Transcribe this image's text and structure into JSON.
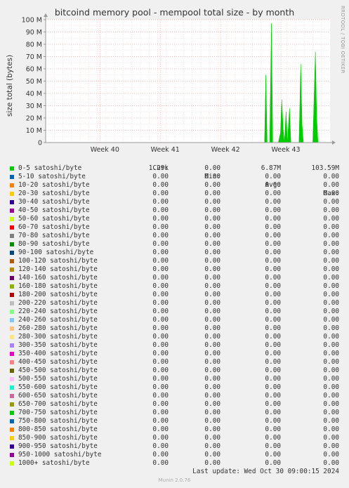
{
  "title": "bitcoind memory pool - mempool total size - by month",
  "side_label": "RRDTOOL / TOBI OETIKER",
  "chart_data": {
    "type": "area",
    "title": "bitcoind memory pool - mempool total size - by month",
    "ylabel": "size total (bytes)",
    "xlabel": "",
    "ylim": [
      0,
      100000000
    ],
    "yticks": [
      {
        "value": 0,
        "label": "0"
      },
      {
        "value": 10000000,
        "label": "10 M"
      },
      {
        "value": 20000000,
        "label": "20 M"
      },
      {
        "value": 30000000,
        "label": "30 M"
      },
      {
        "value": 40000000,
        "label": "40 M"
      },
      {
        "value": 50000000,
        "label": "50 M"
      },
      {
        "value": 60000000,
        "label": "60 M"
      },
      {
        "value": 70000000,
        "label": "70 M"
      },
      {
        "value": 80000000,
        "label": "80 M"
      },
      {
        "value": 90000000,
        "label": "90 M"
      },
      {
        "value": 100000000,
        "label": "100 M"
      }
    ],
    "xlim": [
      0,
      33
    ],
    "xticks": [
      {
        "value": 6.3,
        "label": "Week 40"
      },
      {
        "value": 13.3,
        "label": "Week 41"
      },
      {
        "value": 20.3,
        "label": "Week 42"
      },
      {
        "value": 27.3,
        "label": "Week 43"
      }
    ],
    "grid": true,
    "series": [
      {
        "name": "0-5 satoshi/byte",
        "color": "#00cc00",
        "x": [
          0,
          25.4,
          25.55,
          25.7,
          25.85,
          26.0,
          26.2,
          26.35,
          26.5,
          26.7,
          27.0,
          27.25,
          27.4,
          27.55,
          27.7,
          27.9,
          28.05,
          28.3,
          28.45,
          28.6,
          28.75,
          29.4,
          29.6,
          29.75,
          29.9,
          30.1,
          30.3,
          31.0,
          31.3,
          31.45,
          31.6,
          31.8,
          33
        ],
        "values": [
          0,
          0,
          55000000,
          0,
          0,
          0,
          97000000,
          0,
          0,
          0,
          0,
          8000000,
          35000000,
          12000000,
          0,
          25000000,
          0,
          28000000,
          0,
          0,
          0,
          0,
          64000000,
          15000000,
          0,
          0,
          0,
          0,
          74000000,
          20000000,
          0,
          0,
          0
        ]
      }
    ]
  },
  "legend": {
    "headers": {
      "cur": "Cur:",
      "min": "Min:",
      "avg": "Avg:",
      "max": "Max:"
    },
    "rows": [
      {
        "name": "0-5 satoshi/byte",
        "color": "#00cc00",
        "cur": "1.29k",
        "min": "0.00",
        "avg": "6.87M",
        "max": "103.59M"
      },
      {
        "name": "5-10 satoshi/byte",
        "color": "#0066b3",
        "cur": "0.00",
        "min": "0.00",
        "avg": "0.00",
        "max": "0.00"
      },
      {
        "name": "10-20 satoshi/byte",
        "color": "#ff8000",
        "cur": "0.00",
        "min": "0.00",
        "avg": "0.00",
        "max": "0.00"
      },
      {
        "name": "20-30 satoshi/byte",
        "color": "#ffcc00",
        "cur": "0.00",
        "min": "0.00",
        "avg": "0.00",
        "max": "0.00"
      },
      {
        "name": "30-40 satoshi/byte",
        "color": "#330099",
        "cur": "0.00",
        "min": "0.00",
        "avg": "0.00",
        "max": "0.00"
      },
      {
        "name": "40-50 satoshi/byte",
        "color": "#990099",
        "cur": "0.00",
        "min": "0.00",
        "avg": "0.00",
        "max": "0.00"
      },
      {
        "name": "50-60 satoshi/byte",
        "color": "#ccff00",
        "cur": "0.00",
        "min": "0.00",
        "avg": "0.00",
        "max": "0.00"
      },
      {
        "name": "60-70 satoshi/byte",
        "color": "#ff0000",
        "cur": "0.00",
        "min": "0.00",
        "avg": "0.00",
        "max": "0.00"
      },
      {
        "name": "70-80 satoshi/byte",
        "color": "#808080",
        "cur": "0.00",
        "min": "0.00",
        "avg": "0.00",
        "max": "0.00"
      },
      {
        "name": "80-90 satoshi/byte",
        "color": "#008f00",
        "cur": "0.00",
        "min": "0.00",
        "avg": "0.00",
        "max": "0.00"
      },
      {
        "name": "90-100 satoshi/byte",
        "color": "#00487d",
        "cur": "0.00",
        "min": "0.00",
        "avg": "0.00",
        "max": "0.00"
      },
      {
        "name": "100-120 satoshi/byte",
        "color": "#b35a00",
        "cur": "0.00",
        "min": "0.00",
        "avg": "0.00",
        "max": "0.00"
      },
      {
        "name": "120-140 satoshi/byte",
        "color": "#b38f00",
        "cur": "0.00",
        "min": "0.00",
        "avg": "0.00",
        "max": "0.00"
      },
      {
        "name": "140-160 satoshi/byte",
        "color": "#6b006b",
        "cur": "0.00",
        "min": "0.00",
        "avg": "0.00",
        "max": "0.00"
      },
      {
        "name": "160-180 satoshi/byte",
        "color": "#8fb300",
        "cur": "0.00",
        "min": "0.00",
        "avg": "0.00",
        "max": "0.00"
      },
      {
        "name": "180-200 satoshi/byte",
        "color": "#b30000",
        "cur": "0.00",
        "min": "0.00",
        "avg": "0.00",
        "max": "0.00"
      },
      {
        "name": "200-220 satoshi/byte",
        "color": "#bebebe",
        "cur": "0.00",
        "min": "0.00",
        "avg": "0.00",
        "max": "0.00"
      },
      {
        "name": "220-240 satoshi/byte",
        "color": "#80ff80",
        "cur": "0.00",
        "min": "0.00",
        "avg": "0.00",
        "max": "0.00"
      },
      {
        "name": "240-260 satoshi/byte",
        "color": "#80c9ff",
        "cur": "0.00",
        "min": "0.00",
        "avg": "0.00",
        "max": "0.00"
      },
      {
        "name": "260-280 satoshi/byte",
        "color": "#ffc080",
        "cur": "0.00",
        "min": "0.00",
        "avg": "0.00",
        "max": "0.00"
      },
      {
        "name": "280-300 satoshi/byte",
        "color": "#ffe680",
        "cur": "0.00",
        "min": "0.00",
        "avg": "0.00",
        "max": "0.00"
      },
      {
        "name": "300-350 satoshi/byte",
        "color": "#aa80ff",
        "cur": "0.00",
        "min": "0.00",
        "avg": "0.00",
        "max": "0.00"
      },
      {
        "name": "350-400 satoshi/byte",
        "color": "#ee00cc",
        "cur": "0.00",
        "min": "0.00",
        "avg": "0.00",
        "max": "0.00"
      },
      {
        "name": "400-450 satoshi/byte",
        "color": "#ff8080",
        "cur": "0.00",
        "min": "0.00",
        "avg": "0.00",
        "max": "0.00"
      },
      {
        "name": "450-500 satoshi/byte",
        "color": "#666600",
        "cur": "0.00",
        "min": "0.00",
        "avg": "0.00",
        "max": "0.00"
      },
      {
        "name": "500-550 satoshi/byte",
        "color": "#ffbfff",
        "cur": "0.00",
        "min": "0.00",
        "avg": "0.00",
        "max": "0.00"
      },
      {
        "name": "550-600 satoshi/byte",
        "color": "#00ffcc",
        "cur": "0.00",
        "min": "0.00",
        "avg": "0.00",
        "max": "0.00"
      },
      {
        "name": "600-650 satoshi/byte",
        "color": "#cc6699",
        "cur": "0.00",
        "min": "0.00",
        "avg": "0.00",
        "max": "0.00"
      },
      {
        "name": "650-700 satoshi/byte",
        "color": "#999900",
        "cur": "0.00",
        "min": "0.00",
        "avg": "0.00",
        "max": "0.00"
      },
      {
        "name": "700-750 satoshi/byte",
        "color": "#00cc00",
        "cur": "0.00",
        "min": "0.00",
        "avg": "0.00",
        "max": "0.00"
      },
      {
        "name": "750-800 satoshi/byte",
        "color": "#0066b3",
        "cur": "0.00",
        "min": "0.00",
        "avg": "0.00",
        "max": "0.00"
      },
      {
        "name": "800-850 satoshi/byte",
        "color": "#ff8000",
        "cur": "0.00",
        "min": "0.00",
        "avg": "0.00",
        "max": "0.00"
      },
      {
        "name": "850-900 satoshi/byte",
        "color": "#ffcc00",
        "cur": "0.00",
        "min": "0.00",
        "avg": "0.00",
        "max": "0.00"
      },
      {
        "name": "900-950 satoshi/byte",
        "color": "#330099",
        "cur": "0.00",
        "min": "0.00",
        "avg": "0.00",
        "max": "0.00"
      },
      {
        "name": "950-1000 satoshi/byte",
        "color": "#990099",
        "cur": "0.00",
        "min": "0.00",
        "avg": "0.00",
        "max": "0.00"
      },
      {
        "name": "1000+ satoshi/byte",
        "color": "#ccff00",
        "cur": "0.00",
        "min": "0.00",
        "avg": "0.00",
        "max": "0.00"
      }
    ]
  },
  "last_update": "Last update: Wed Oct 30 09:00:15 2024",
  "footer": "Munin 2.0.76"
}
